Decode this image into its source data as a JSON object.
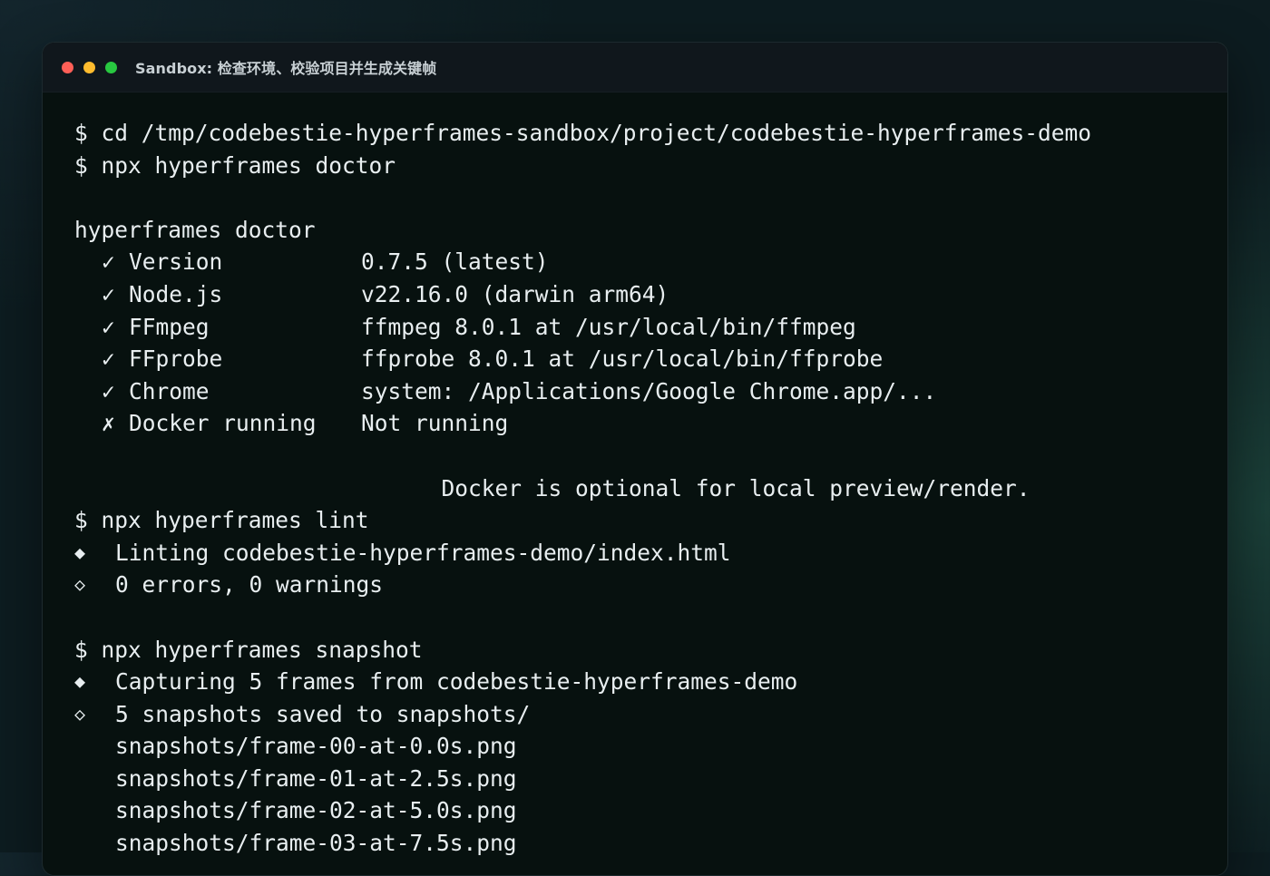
{
  "window": {
    "title": "Sandbox: 检查环境、校验项目并生成关键帧",
    "traffic_lights": {
      "close_color": "#ff5f57",
      "minimize_color": "#febc2e",
      "maximize_color": "#28c840"
    }
  },
  "terminal": {
    "prompt_symbol": "$",
    "cmd_cd": "cd /tmp/codebestie-hyperframes-sandbox/project/codebestie-hyperframes-demo",
    "cmd_doctor": "npx hyperframes doctor",
    "doctor": {
      "heading": "hyperframes doctor",
      "checks": [
        {
          "mark": "✓",
          "name": "Version",
          "value": "0.7.5 (latest)"
        },
        {
          "mark": "✓",
          "name": "Node.js",
          "value": "v22.16.0 (darwin arm64)"
        },
        {
          "mark": "✓",
          "name": "FFmpeg",
          "value": "ffmpeg 8.0.1 at /usr/local/bin/ffmpeg"
        },
        {
          "mark": "✓",
          "name": "FFprobe",
          "value": "ffprobe 8.0.1 at /usr/local/bin/ffprobe"
        },
        {
          "mark": "✓",
          "name": "Chrome",
          "value": "system: /Applications/Google Chrome.app/..."
        },
        {
          "mark": "✗",
          "name": "Docker running",
          "value": "Not running"
        }
      ],
      "docker_note": "Docker is optional for local preview/render."
    },
    "cmd_lint": "npx hyperframes lint",
    "lint": {
      "start_bullet": "◆",
      "start_text": "Linting codebestie-hyperframes-demo/index.html",
      "end_bullet": "◇",
      "end_text": "0 errors, 0 warnings"
    },
    "cmd_snapshot": "npx hyperframes snapshot",
    "snapshot": {
      "start_bullet": "◆",
      "start_text": "Capturing 5 frames from codebestie-hyperframes-demo",
      "end_bullet": "◇",
      "end_text": "5 snapshots saved to snapshots/",
      "files": [
        "snapshots/frame-00-at-0.0s.png",
        "snapshots/frame-01-at-2.5s.png",
        "snapshots/frame-02-at-5.0s.png",
        "snapshots/frame-03-at-7.5s.png"
      ]
    }
  }
}
